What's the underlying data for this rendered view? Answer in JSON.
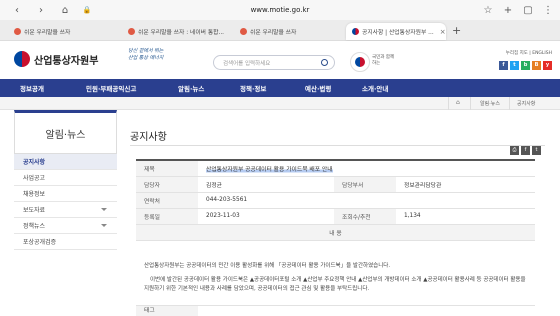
{
  "browser": {
    "url": "www.motie.go.kr",
    "tabs": [
      {
        "label": "쉬운 우리말을 쓰자"
      },
      {
        "label": "쉬운 우리말을 쓰자 : 네이버 통합..."
      },
      {
        "label": "쉬운 우리말을 쓰자"
      },
      {
        "label": "공지사항 | 산업통상자원부 ..."
      }
    ]
  },
  "header": {
    "logo": "산업통상자원부",
    "slogan_line1": "당신 곁에서 뛰는",
    "slogan_line2": "산업 통상 에너지",
    "search_placeholder": "검색어를 입력하세요",
    "gov_text": "국민과 함께하는",
    "top_links": "누리집 지도 | ENGLISH",
    "sns": [
      "f",
      "t",
      "b",
      "B",
      "y"
    ]
  },
  "nav": [
    "정보공개",
    "민원·부패공익신고",
    "알림·뉴스",
    "정책·정보",
    "예산·법령",
    "소개·안내"
  ],
  "breadcrumb": [
    "알림·뉴스",
    "공지사항"
  ],
  "sidebar": {
    "title": "알림·뉴스",
    "items": [
      "공지사항",
      "사업공고",
      "채용정보",
      "보도자료",
      "정책뉴스",
      "포상공개검증"
    ]
  },
  "content": {
    "title": "공지사항",
    "rows": {
      "subject_label": "제목",
      "subject": "산업통상자원부 공공데이터 활용 가이드북 배포 안내",
      "author_label": "담당자",
      "author": "김정균",
      "dept_label": "담당부서",
      "dept": "정보관리담당관",
      "contact_label": "연락처",
      "contact": "044-203-5561",
      "date_label": "등록일",
      "date": "2023-11-03",
      "views_label": "조회수/추천",
      "views": "1,134",
      "content_label": "내 용"
    },
    "body_p1": "산업통상자원부는 공공데이터의 민간 이용 활성화를 위해 「공공데이터 활용 가이드북」을 발간하였습니다.",
    "body_p2": "이번에 발간된 공공데이터 활용 가이드북은 ▲공공데이터포털 소개 ▲산업부 주요정책 안내 ▲산업부의 개방데이터 소개 ▲공공데이터 활용사례 등 공공데이터 활용을 지원하기 위한 기본적인 내용과 사례를 담았으며, 공공데이터의 접근 관심 및 활용을 부탁드립니다.",
    "tag_label": "태그"
  }
}
